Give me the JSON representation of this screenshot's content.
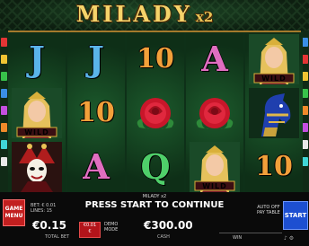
{
  "header": {
    "title": "MILADY",
    "multiplier": "x2"
  },
  "reels": [
    [
      "J",
      "WILD",
      "queen"
    ],
    [
      "J",
      "10",
      "A"
    ],
    [
      "10",
      "rose",
      "Q"
    ],
    [
      "A",
      "rose",
      "WILD"
    ],
    [
      "WILD",
      "horse",
      "10"
    ]
  ],
  "wild_label": "WILD",
  "game_name": "MILADY x2",
  "message": "PRESS START TO CONTINUE",
  "menu_button": {
    "line1": "GAME",
    "line2": "MENU"
  },
  "bet_info": {
    "bet": "BET: € 0.01",
    "lines": "LINES: 15"
  },
  "total_bet": {
    "value": "€0.15",
    "label": "TOTAL BET"
  },
  "bet_button": {
    "line1": "€0.01",
    "line2": "€"
  },
  "mode": {
    "line1": "DEMO",
    "line2": "MODE"
  },
  "cash": {
    "value": "€300.00",
    "label": "CASH"
  },
  "auto": {
    "line1": "AUTO OFF",
    "line2": "PAY TABLE"
  },
  "start_button": "START",
  "win_label": "WIN",
  "colors": {
    "gold": "#f5d36a",
    "menu_red": "#c21f1f",
    "start_blue": "#1d4fd1",
    "J": "#5ab4ea",
    "A": "#e06ec0",
    "10": "#f2a03a",
    "Q": "#4fcf6a"
  }
}
